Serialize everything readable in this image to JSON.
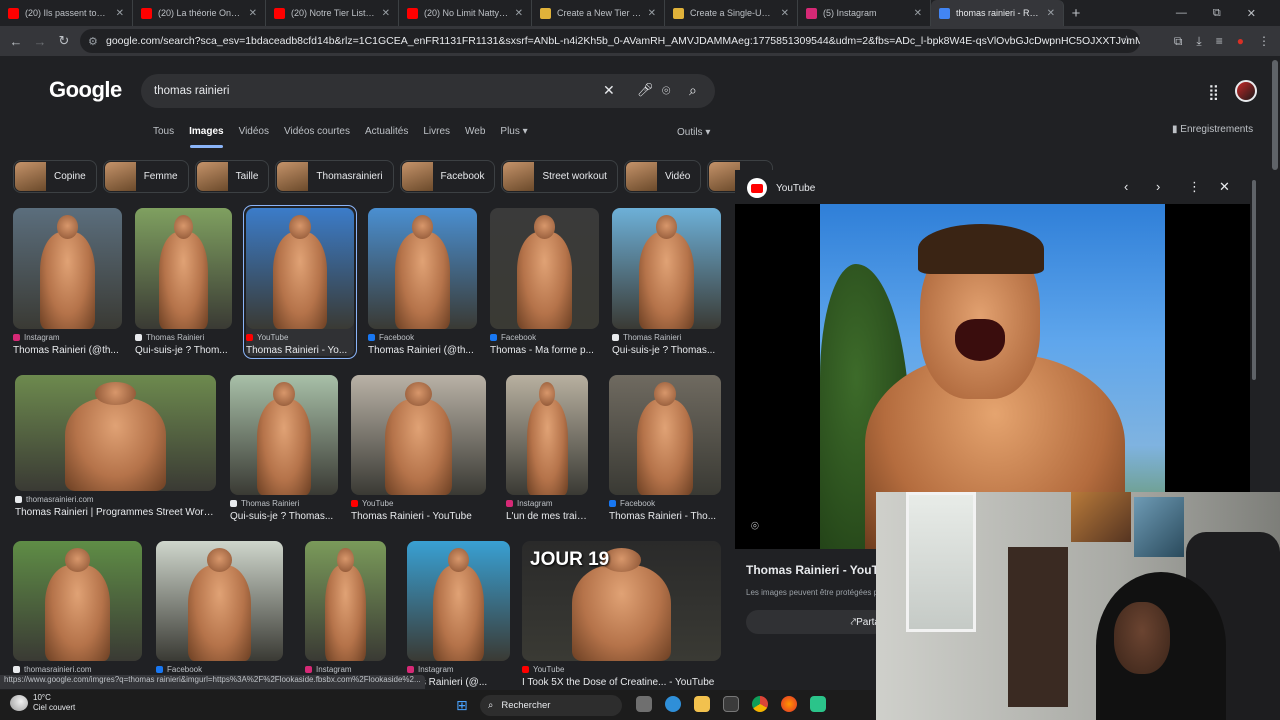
{
  "browser": {
    "tabs": [
      {
        "title": "(20) Ils passent tout l'été",
        "fav": "#ff0000"
      },
      {
        "title": "(20) La théorie One Piece",
        "fav": "#ff0000"
      },
      {
        "title": "(20) Notre Tier List des FA",
        "fav": "#ff0000"
      },
      {
        "title": "(20) No Limit Natty Podca",
        "fav": "#ff0000"
      },
      {
        "title": "Create a New Tier List - T",
        "fav": "#e0b23a"
      },
      {
        "title": "Create a Single-Use Tier",
        "fav": "#e0b23a"
      },
      {
        "title": "(5) Instagram",
        "fav": "#d62976"
      },
      {
        "title": "thomas rainieri - Recherc",
        "fav": "#4285f4"
      }
    ],
    "new_tab": "+",
    "window_controls": {
      "minimize": "—",
      "restore": "⧉",
      "close": "✕"
    },
    "url": "google.com/search?sca_esv=1bdaceadb8cfd14b&rlz=1C1GCEA_enFR1131FR1131&sxsrf=ANbL-n4i2Kh5b_0-AVamRH_AMVJDAMMAeg:1775851309544&udm=2&fbs=ADc_l-bpk8W4E-qsVlOvbGJcDwpnHC5OJXXTJvmMu2n9YYx-G8xzgQk24aW..."
  },
  "google": {
    "logo": "Google",
    "query": "thomas rainieri",
    "filters": [
      "Tous",
      "Images",
      "Vidéos",
      "Vidéos courtes",
      "Actualités",
      "Livres",
      "Web",
      "Plus ▾"
    ],
    "tools": "Outils ▾",
    "saved": "Enregistrements",
    "chips": [
      "Copine",
      "Femme",
      "Taille",
      "Thomasrainieri",
      "Facebook",
      "Street workout",
      "Vidéo",
      "Mu"
    ],
    "results_row1": [
      {
        "source": "Instagram",
        "title": "Thomas Rainieri (@th...",
        "color": "#d62976"
      },
      {
        "source": "Thomas Rainieri",
        "title": "Qui-suis-je ? Thom...",
        "color": "#e8eaed"
      },
      {
        "source": "YouTube",
        "title": "Thomas Rainieri - Yo...",
        "color": "#ff0000"
      },
      {
        "source": "Facebook",
        "title": "Thomas Rainieri (@th...",
        "color": "#1877f2"
      },
      {
        "source": "Facebook",
        "title": "Thomas - Ma forme p...",
        "color": "#1877f2"
      },
      {
        "source": "Thomas Rainieri",
        "title": "Qui-suis-je ? Thomas...",
        "color": "#e8eaed"
      }
    ],
    "results_row2": [
      {
        "source": "thomasrainieri.com",
        "title": "Thomas Rainieri | Programmes Street Work...",
        "color": "#e8eaed"
      },
      {
        "source": "Thomas Rainieri",
        "title": "Qui-suis-je ? Thomas...",
        "color": "#e8eaed"
      },
      {
        "source": "YouTube",
        "title": "Thomas Rainieri - YouTube",
        "color": "#ff0000"
      },
      {
        "source": "Instagram",
        "title": "L'un de mes trainin...",
        "color": "#d62976"
      },
      {
        "source": "Facebook",
        "title": "Thomas Rainieri - Tho...",
        "color": "#1877f2"
      }
    ],
    "results_row3": [
      {
        "source": "thomasrainieri.com",
        "title": "",
        "color": "#e8eaed"
      },
      {
        "source": "Facebook",
        "title": "",
        "color": "#1877f2"
      },
      {
        "source": "Instagram",
        "title": "",
        "color": "#d62976"
      },
      {
        "source": "Instagram",
        "title": "mas Rainieri (@...",
        "color": "#d62976"
      },
      {
        "source": "YouTube",
        "title": "I Took 5X the Dose of Creatine... - YouTube",
        "color": "#ff0000",
        "overlay": "JOUR 19"
      }
    ]
  },
  "preview": {
    "source": "YouTube",
    "title": "Thomas Rainieri - YouTu",
    "note": "Les images peuvent être protégées p",
    "share": "Parta"
  },
  "status_url": "https://www.google.com/imgres?q=thomas rainieri&imgurl=https%3A%2F%2Flookaside.fbsbx.com%2Flookaside%2...",
  "taskbar": {
    "temp": "10°C",
    "weather": "Ciel couvert",
    "search": "Rechercher"
  }
}
